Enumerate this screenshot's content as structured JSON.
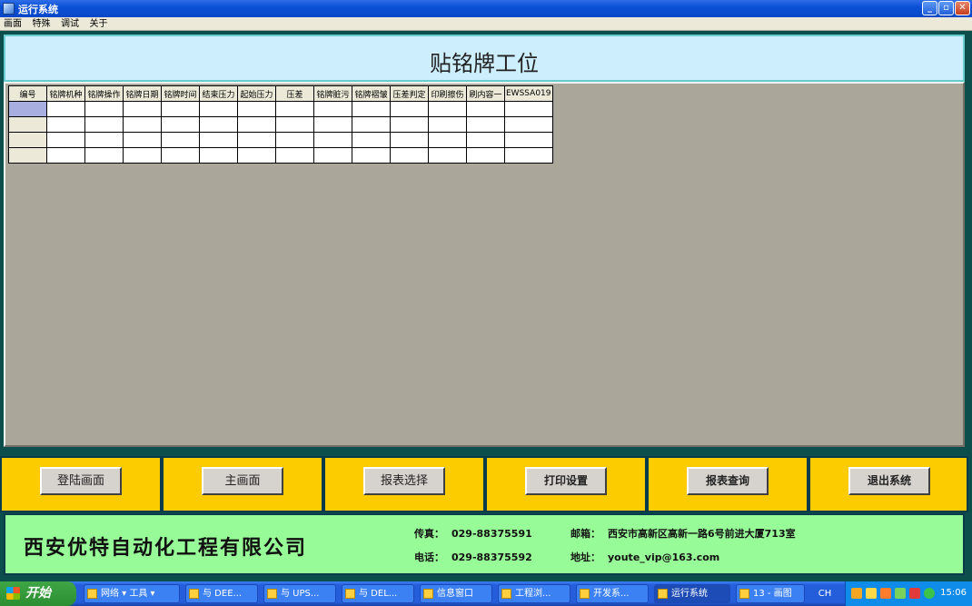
{
  "window": {
    "title": "运行系统"
  },
  "menu": [
    "画面",
    "特殊",
    "调试",
    "关于"
  ],
  "page_title": "贴铭牌工位",
  "grid": {
    "columns": [
      "编号",
      "铭牌机种",
      "铭牌操作",
      "铭牌日期",
      "铭牌时间",
      "结束压力",
      "起始压力",
      "压差",
      "铭牌脏污",
      "铭牌褶皱",
      "压差判定",
      "印刷擦伤",
      "刷内容一",
      "EWSSA019"
    ],
    "rows": 4
  },
  "buttons": [
    {
      "label": "登陆画面"
    },
    {
      "label": "主画面"
    },
    {
      "label": "报表选择"
    },
    {
      "label": "打印设置"
    },
    {
      "label": "报表查询"
    },
    {
      "label": "退出系统"
    }
  ],
  "footer": {
    "company": "西安优特自动化工程有限公司",
    "fax_label": "传真：",
    "fax": "029-88375591",
    "phone_label": "电话：",
    "phone": "029-88375592",
    "mail_label": "邮箱：",
    "mail": "西安市高新区高新一路6号前进大厦713室",
    "addr_label": "地址：",
    "addr": "youte_vip@163.com"
  },
  "taskbar": {
    "start": "开始",
    "tasks": [
      "网络 ▾ 工具 ▾",
      "与 DEE...",
      "与 UPS...",
      "与 DEL...",
      "信息窗口",
      "工程浏...",
      "开发系...",
      "运行系统",
      "13 - 画图"
    ],
    "lang": "CH",
    "clock": "15:06"
  }
}
